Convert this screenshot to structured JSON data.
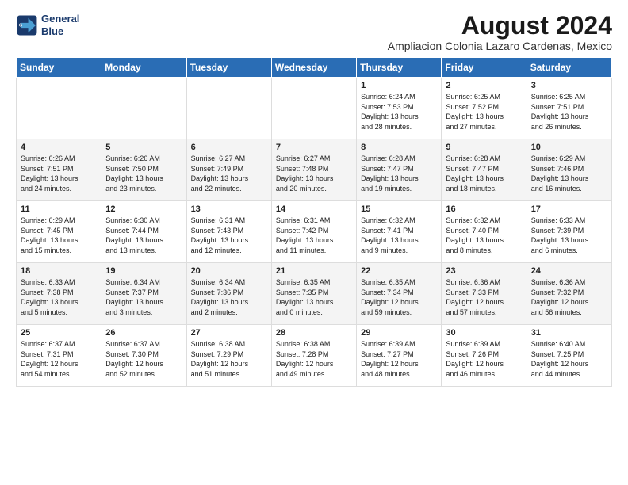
{
  "header": {
    "logo_line1": "General",
    "logo_line2": "Blue",
    "month_year": "August 2024",
    "location": "Ampliacion Colonia Lazaro Cardenas, Mexico"
  },
  "weekdays": [
    "Sunday",
    "Monday",
    "Tuesday",
    "Wednesday",
    "Thursday",
    "Friday",
    "Saturday"
  ],
  "weeks": [
    [
      {
        "day": "",
        "info": ""
      },
      {
        "day": "",
        "info": ""
      },
      {
        "day": "",
        "info": ""
      },
      {
        "day": "",
        "info": ""
      },
      {
        "day": "1",
        "info": "Sunrise: 6:24 AM\nSunset: 7:53 PM\nDaylight: 13 hours\nand 28 minutes."
      },
      {
        "day": "2",
        "info": "Sunrise: 6:25 AM\nSunset: 7:52 PM\nDaylight: 13 hours\nand 27 minutes."
      },
      {
        "day": "3",
        "info": "Sunrise: 6:25 AM\nSunset: 7:51 PM\nDaylight: 13 hours\nand 26 minutes."
      }
    ],
    [
      {
        "day": "4",
        "info": "Sunrise: 6:26 AM\nSunset: 7:51 PM\nDaylight: 13 hours\nand 24 minutes."
      },
      {
        "day": "5",
        "info": "Sunrise: 6:26 AM\nSunset: 7:50 PM\nDaylight: 13 hours\nand 23 minutes."
      },
      {
        "day": "6",
        "info": "Sunrise: 6:27 AM\nSunset: 7:49 PM\nDaylight: 13 hours\nand 22 minutes."
      },
      {
        "day": "7",
        "info": "Sunrise: 6:27 AM\nSunset: 7:48 PM\nDaylight: 13 hours\nand 20 minutes."
      },
      {
        "day": "8",
        "info": "Sunrise: 6:28 AM\nSunset: 7:47 PM\nDaylight: 13 hours\nand 19 minutes."
      },
      {
        "day": "9",
        "info": "Sunrise: 6:28 AM\nSunset: 7:47 PM\nDaylight: 13 hours\nand 18 minutes."
      },
      {
        "day": "10",
        "info": "Sunrise: 6:29 AM\nSunset: 7:46 PM\nDaylight: 13 hours\nand 16 minutes."
      }
    ],
    [
      {
        "day": "11",
        "info": "Sunrise: 6:29 AM\nSunset: 7:45 PM\nDaylight: 13 hours\nand 15 minutes."
      },
      {
        "day": "12",
        "info": "Sunrise: 6:30 AM\nSunset: 7:44 PM\nDaylight: 13 hours\nand 13 minutes."
      },
      {
        "day": "13",
        "info": "Sunrise: 6:31 AM\nSunset: 7:43 PM\nDaylight: 13 hours\nand 12 minutes."
      },
      {
        "day": "14",
        "info": "Sunrise: 6:31 AM\nSunset: 7:42 PM\nDaylight: 13 hours\nand 11 minutes."
      },
      {
        "day": "15",
        "info": "Sunrise: 6:32 AM\nSunset: 7:41 PM\nDaylight: 13 hours\nand 9 minutes."
      },
      {
        "day": "16",
        "info": "Sunrise: 6:32 AM\nSunset: 7:40 PM\nDaylight: 13 hours\nand 8 minutes."
      },
      {
        "day": "17",
        "info": "Sunrise: 6:33 AM\nSunset: 7:39 PM\nDaylight: 13 hours\nand 6 minutes."
      }
    ],
    [
      {
        "day": "18",
        "info": "Sunrise: 6:33 AM\nSunset: 7:38 PM\nDaylight: 13 hours\nand 5 minutes."
      },
      {
        "day": "19",
        "info": "Sunrise: 6:34 AM\nSunset: 7:37 PM\nDaylight: 13 hours\nand 3 minutes."
      },
      {
        "day": "20",
        "info": "Sunrise: 6:34 AM\nSunset: 7:36 PM\nDaylight: 13 hours\nand 2 minutes."
      },
      {
        "day": "21",
        "info": "Sunrise: 6:35 AM\nSunset: 7:35 PM\nDaylight: 13 hours\nand 0 minutes."
      },
      {
        "day": "22",
        "info": "Sunrise: 6:35 AM\nSunset: 7:34 PM\nDaylight: 12 hours\nand 59 minutes."
      },
      {
        "day": "23",
        "info": "Sunrise: 6:36 AM\nSunset: 7:33 PM\nDaylight: 12 hours\nand 57 minutes."
      },
      {
        "day": "24",
        "info": "Sunrise: 6:36 AM\nSunset: 7:32 PM\nDaylight: 12 hours\nand 56 minutes."
      }
    ],
    [
      {
        "day": "25",
        "info": "Sunrise: 6:37 AM\nSunset: 7:31 PM\nDaylight: 12 hours\nand 54 minutes."
      },
      {
        "day": "26",
        "info": "Sunrise: 6:37 AM\nSunset: 7:30 PM\nDaylight: 12 hours\nand 52 minutes."
      },
      {
        "day": "27",
        "info": "Sunrise: 6:38 AM\nSunset: 7:29 PM\nDaylight: 12 hours\nand 51 minutes."
      },
      {
        "day": "28",
        "info": "Sunrise: 6:38 AM\nSunset: 7:28 PM\nDaylight: 12 hours\nand 49 minutes."
      },
      {
        "day": "29",
        "info": "Sunrise: 6:39 AM\nSunset: 7:27 PM\nDaylight: 12 hours\nand 48 minutes."
      },
      {
        "day": "30",
        "info": "Sunrise: 6:39 AM\nSunset: 7:26 PM\nDaylight: 12 hours\nand 46 minutes."
      },
      {
        "day": "31",
        "info": "Sunrise: 6:40 AM\nSunset: 7:25 PM\nDaylight: 12 hours\nand 44 minutes."
      }
    ]
  ]
}
